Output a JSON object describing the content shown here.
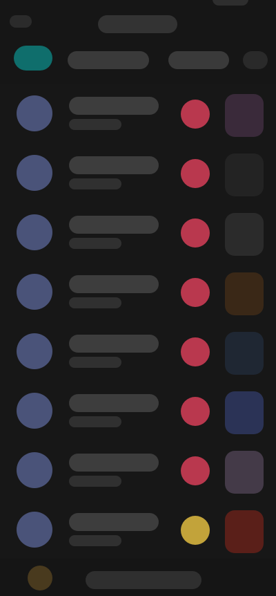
{
  "topbar": {
    "title": "",
    "back_label": ""
  },
  "list": {
    "header": {
      "col1": "",
      "col2": "",
      "col3": ""
    },
    "rows": [
      {
        "primary": "",
        "secondary": "",
        "status": "red",
        "thumb": "purple"
      },
      {
        "primary": "",
        "secondary": "",
        "status": "red",
        "thumb": "gray"
      },
      {
        "primary": "",
        "secondary": "",
        "status": "red",
        "thumb": "gray"
      },
      {
        "primary": "",
        "secondary": "",
        "status": "red",
        "thumb": "brown"
      },
      {
        "primary": "",
        "secondary": "",
        "status": "red",
        "thumb": "navy"
      },
      {
        "primary": "",
        "secondary": "",
        "status": "red",
        "thumb": "blue"
      },
      {
        "primary": "",
        "secondary": "",
        "status": "red",
        "thumb": "mauve"
      },
      {
        "primary": "",
        "secondary": "",
        "status": "yellow",
        "thumb": "red"
      }
    ]
  },
  "footer": {
    "label": ""
  },
  "colors": {
    "accent_teal": "#0f6e6c",
    "avatar_blue": "#4a5379",
    "status_red": "#b9384e",
    "status_yellow": "#c2a33a"
  }
}
